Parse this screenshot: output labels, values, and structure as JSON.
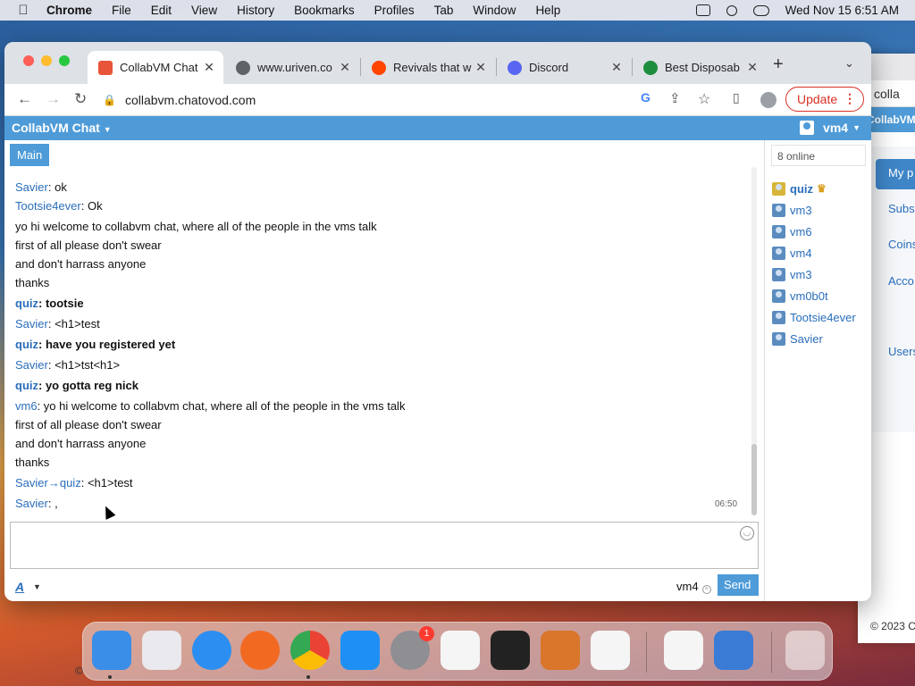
{
  "menubar": {
    "apple": "",
    "app": "Chrome",
    "items": [
      "File",
      "Edit",
      "View",
      "History",
      "Bookmarks",
      "Profiles",
      "Tab",
      "Window",
      "Help"
    ],
    "datetime": "Wed Nov 15  6:51 AM"
  },
  "browser": {
    "tabs": [
      {
        "title": "CollabVM Chat",
        "favicon_color": "#e8553a",
        "active": true
      },
      {
        "title": "www.uriven.co",
        "favicon_color": "#5f6368",
        "active": false
      },
      {
        "title": "Revivals that w",
        "favicon_color": "#ff4500",
        "active": false
      },
      {
        "title": "Discord",
        "favicon_color": "#5865f2",
        "active": false
      },
      {
        "title": "Best Disposab",
        "favicon_color": "#1e8e3e",
        "active": false
      }
    ],
    "new_tab": "+",
    "tab_menu": "⌄",
    "url": "collabvm.chatovod.com",
    "update_label": "Update"
  },
  "chat": {
    "app_title": "CollabVM Chat",
    "current_user": "vm4",
    "room_tab": "Main",
    "messages": [
      {
        "nick": "Savier",
        "sep": ": ",
        "text": "ok",
        "bold": false
      },
      {
        "nick": "Tootsie4ever",
        "sep": ": ",
        "text": "Ok",
        "bold": false
      },
      {
        "nick": "",
        "sep": "",
        "text": "yo hi welcome to collabvm chat, where all of the people in the vms talk",
        "bold": false
      },
      {
        "nick": "",
        "sep": "",
        "text": "first of all please don't swear",
        "bold": false
      },
      {
        "nick": "",
        "sep": "",
        "text": "and don't harrass anyone",
        "bold": false
      },
      {
        "nick": "",
        "sep": "",
        "text": "thanks",
        "bold": false
      },
      {
        "nick": "quiz",
        "sep": ": ",
        "text": "tootsie",
        "bold": true
      },
      {
        "nick": "Savier",
        "sep": ": ",
        "text": "<h1>test",
        "bold": false
      },
      {
        "nick": "quiz",
        "sep": ": ",
        "text": "have you registered yet",
        "bold": true
      },
      {
        "nick": "Savier",
        "sep": ": ",
        "text": "<h1>tst<h1>",
        "bold": false
      },
      {
        "nick": "quiz",
        "sep": ": ",
        "text": "yo gotta reg nick",
        "bold": true
      },
      {
        "nick": "vm6",
        "sep": ": ",
        "text": "yo hi welcome to collabvm chat, where all of the people in the vms talk",
        "bold": false
      },
      {
        "nick": "",
        "sep": "",
        "text": "first of all please don't swear",
        "bold": false
      },
      {
        "nick": "",
        "sep": "",
        "text": "and don't harrass anyone",
        "bold": false
      },
      {
        "nick": "",
        "sep": "",
        "text": "thanks",
        "bold": false
      },
      {
        "nick": "Savier→quiz",
        "sep": ": ",
        "text": "<h1>test",
        "bold": false
      },
      {
        "nick": "Savier",
        "sep": ": ",
        "text": ",",
        "bold": false
      }
    ],
    "last_timestamp": "06:50",
    "input_value": "",
    "format_label": "A",
    "nick_label": "vm4",
    "send_label": "Send"
  },
  "users": {
    "online_label": "8 online",
    "list": [
      {
        "name": "quiz",
        "op": true
      },
      {
        "name": "vm3",
        "op": false
      },
      {
        "name": "vm6",
        "op": false
      },
      {
        "name": "vm4",
        "op": false
      },
      {
        "name": "vm3",
        "op": false
      },
      {
        "name": "vm0b0t",
        "op": false
      },
      {
        "name": "Tootsie4ever",
        "op": false
      },
      {
        "name": "Savier",
        "op": false
      }
    ]
  },
  "background_window": {
    "addr": "colla",
    "header": "CollabVM",
    "my_button": "My p",
    "links": [
      "Subs",
      "Coins",
      "Acco",
      "Users"
    ],
    "copyright": "© 2023 C",
    "left_copyright": "©"
  },
  "dock": {
    "apps": [
      "finder-icon",
      "launchpad-icon",
      "safari-icon",
      "firefox-icon",
      "chrome-icon",
      "app-store-icon",
      "system-settings-icon",
      "textedit-icon",
      "terminal-icon",
      "garageband-icon",
      "vscode-icon",
      "visual-studio-icon",
      "weather-icon",
      "trash-icon"
    ],
    "settings_badge": "1"
  }
}
